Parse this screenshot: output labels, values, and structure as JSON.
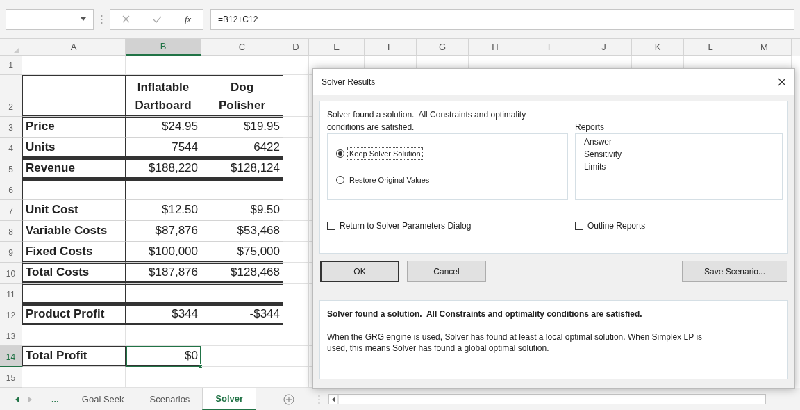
{
  "formula_bar": {
    "fx_label": "fx",
    "formula": "=B12+C12"
  },
  "columns": [
    {
      "label": "A",
      "selected": false
    },
    {
      "label": "B",
      "selected": true
    },
    {
      "label": "C",
      "selected": false
    },
    {
      "label": "D",
      "selected": false
    },
    {
      "label": "E",
      "selected": false
    },
    {
      "label": "F",
      "selected": false
    },
    {
      "label": "G",
      "selected": false
    },
    {
      "label": "H",
      "selected": false
    },
    {
      "label": "I",
      "selected": false
    },
    {
      "label": "J",
      "selected": false
    },
    {
      "label": "K",
      "selected": false
    },
    {
      "label": "L",
      "selected": false
    },
    {
      "label": "M",
      "selected": false
    }
  ],
  "rows": [
    {
      "number": "1",
      "selected": false,
      "kind": "blank",
      "cells": []
    },
    {
      "number": "2",
      "selected": false,
      "kind": "heading",
      "rule_above": true,
      "rule_below": true,
      "cells": [
        {
          "active": false
        },
        {
          "text": "Inflatable\nDartboard",
          "active": false
        },
        {
          "text": "Dog\nPolisher",
          "active": false
        }
      ]
    },
    {
      "number": "3",
      "selected": false,
      "kind": "table",
      "rule_above": true,
      "rule_below": false,
      "cells": [
        {
          "text": "Price",
          "active": false
        },
        {
          "text": "$24.95",
          "active": false
        },
        {
          "text": "$19.95",
          "active": false
        }
      ]
    },
    {
      "number": "4",
      "selected": false,
      "kind": "table",
      "rule_above": false,
      "rule_below": true,
      "cells": [
        {
          "text": "Units",
          "active": false
        },
        {
          "text": "7544",
          "active": false
        },
        {
          "text": "6422",
          "active": false
        }
      ]
    },
    {
      "number": "5",
      "selected": false,
      "kind": "table",
      "rule_above": true,
      "rule_below": true,
      "cells": [
        {
          "text": "Revenue",
          "active": false
        },
        {
          "text": "$188,220",
          "active": false
        },
        {
          "text": "$128,124",
          "active": false
        }
      ]
    },
    {
      "number": "6",
      "selected": false,
      "kind": "table",
      "rule_above": true,
      "rule_below": false,
      "cells": [
        {
          "active": false
        },
        {
          "active": false
        },
        {
          "active": false
        }
      ]
    },
    {
      "number": "7",
      "selected": false,
      "kind": "table",
      "rule_above": false,
      "rule_below": false,
      "cells": [
        {
          "text": "Unit Cost",
          "active": false
        },
        {
          "text": "$12.50",
          "active": false
        },
        {
          "text": "$9.50",
          "active": false
        }
      ]
    },
    {
      "number": "8",
      "selected": false,
      "kind": "table",
      "rule_above": false,
      "rule_below": false,
      "cells": [
        {
          "text": "Variable Costs",
          "active": false
        },
        {
          "text": "$87,876",
          "active": false
        },
        {
          "text": "$53,468",
          "active": false
        }
      ]
    },
    {
      "number": "9",
      "selected": false,
      "kind": "table",
      "rule_above": false,
      "rule_below": true,
      "cells": [
        {
          "text": "Fixed Costs",
          "active": false
        },
        {
          "text": "$100,000",
          "active": false
        },
        {
          "text": "$75,000",
          "active": false
        }
      ]
    },
    {
      "number": "10",
      "selected": false,
      "kind": "table",
      "rule_above": true,
      "rule_below": true,
      "cells": [
        {
          "text": "Total Costs",
          "active": false
        },
        {
          "text": "$187,876",
          "active": false
        },
        {
          "text": "$128,468",
          "active": false
        }
      ]
    },
    {
      "number": "11",
      "selected": false,
      "kind": "table",
      "rule_above": true,
      "rule_below": true,
      "cells": [
        {
          "active": false
        },
        {
          "active": false
        },
        {
          "active": false
        }
      ]
    },
    {
      "number": "12",
      "selected": false,
      "kind": "table",
      "rule_above": true,
      "rule_below": true,
      "cells": [
        {
          "text": "Product Profit",
          "active": false
        },
        {
          "text": "$344",
          "active": false
        },
        {
          "text": "-$344",
          "active": false
        }
      ]
    },
    {
      "number": "13",
      "selected": false,
      "kind": "blank",
      "cells": []
    },
    {
      "number": "14",
      "selected": true,
      "kind": "table",
      "rule_above": true,
      "rule_below": true,
      "cells": [
        {
          "text": "Total Profit",
          "active": false
        },
        {
          "text": "$0",
          "active": true
        }
      ]
    },
    {
      "number": "15",
      "selected": false,
      "kind": "blank",
      "cells": []
    }
  ],
  "sheet_tabs": {
    "overflow": "...",
    "tabs": [
      {
        "label": "Goal Seek",
        "selected": false
      },
      {
        "label": "Scenarios",
        "selected": false
      },
      {
        "label": "Solver",
        "selected": true
      }
    ]
  },
  "dialog": {
    "title": "Solver Results",
    "message": "Solver found a solution.  All Constraints and optimality conditions are satisfied.",
    "radios": [
      {
        "label": "Keep Solver Solution",
        "selected": true
      },
      {
        "label": "Restore Original Values",
        "selected": false
      }
    ],
    "reports_label": "Reports",
    "reports": [
      "Answer",
      "Sensitivity",
      "Limits"
    ],
    "checkboxes": [
      {
        "label": "Return to Solver Parameters Dialog",
        "checked": false
      },
      {
        "label": "Outline Reports",
        "checked": false
      }
    ],
    "buttons": [
      {
        "label": "OK",
        "default": true
      },
      {
        "label": "Cancel",
        "default": false
      },
      {
        "label": "Save Scenario...",
        "default": false
      }
    ],
    "info_title": "Solver found a solution.  All Constraints and optimality conditions are satisfied.",
    "info_text": "When the GRG engine is used, Solver has found at least a local optimal solution. When Simplex LP is used, this means Solver has found a global optimal solution."
  }
}
